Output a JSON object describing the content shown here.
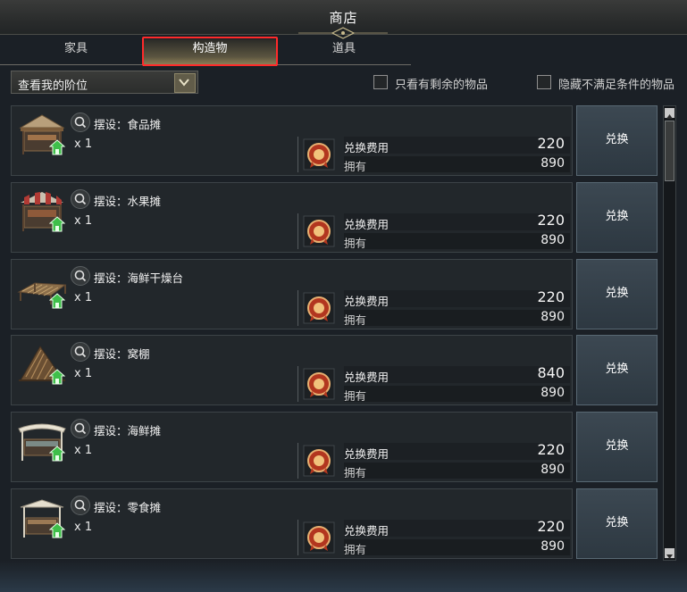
{
  "window": {
    "title": "商店"
  },
  "tabs": [
    {
      "label": "家具"
    },
    {
      "label": "构造物"
    },
    {
      "label": "道具"
    }
  ],
  "filters": {
    "rank_dropdown": "查看我的阶位",
    "checkbox_remaining": "只看有剩余的物品",
    "checkbox_hide_unmet": "隐藏不满足条件的物品"
  },
  "colors": {
    "accent": "#c9b57d",
    "highlight_box": "#ff2a2a",
    "button": "#33404a"
  },
  "items": [
    {
      "name": "摆设：食品摊",
      "qty": "x 1",
      "fee_label": "兑换费用",
      "fee": "220",
      "owned_label": "拥有",
      "owned": "890",
      "button": "兑换",
      "icon": "food-stall-icon"
    },
    {
      "name": "摆设：水果摊",
      "qty": "x 1",
      "fee_label": "兑换费用",
      "fee": "220",
      "owned_label": "拥有",
      "owned": "890",
      "button": "兑换",
      "icon": "fruit-stall-icon"
    },
    {
      "name": "摆设：海鲜干燥台",
      "qty": "x 1",
      "fee_label": "兑换费用",
      "fee": "220",
      "owned_label": "拥有",
      "owned": "890",
      "button": "兑换",
      "icon": "drying-rack-icon"
    },
    {
      "name": "摆设：窝棚",
      "qty": "x 1",
      "fee_label": "兑换费用",
      "fee": "840",
      "owned_label": "拥有",
      "owned": "890",
      "button": "兑换",
      "icon": "shack-icon"
    },
    {
      "name": "摆设：海鲜摊",
      "qty": "x 1",
      "fee_label": "兑换费用",
      "fee": "220",
      "owned_label": "拥有",
      "owned": "890",
      "button": "兑换",
      "icon": "seafood-stall-icon"
    },
    {
      "name": "摆设：零食摊",
      "qty": "x 1",
      "fee_label": "兑换费用",
      "fee": "220",
      "owned_label": "拥有",
      "owned": "890",
      "button": "兑换",
      "icon": "snack-stall-icon"
    }
  ]
}
